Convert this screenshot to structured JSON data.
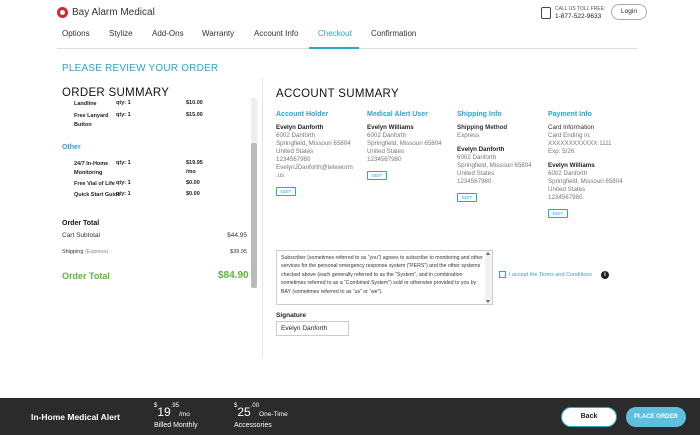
{
  "brand": {
    "logo_text": "Bay Alarm Medical",
    "accent": "#2aa6c9",
    "green": "#5db442",
    "logo_red": "#d9262c"
  },
  "header": {
    "call_label": "CALL US TOLL FREE:",
    "phone": "1-877-522-9633",
    "login_label": "Login"
  },
  "nav": {
    "items": [
      {
        "label": "Options"
      },
      {
        "label": "Stylize"
      },
      {
        "label": "Add-Ons"
      },
      {
        "label": "Warranty"
      },
      {
        "label": "Account Info"
      },
      {
        "label": "Checkout",
        "active": true
      },
      {
        "label": "Confirmation"
      }
    ]
  },
  "page": {
    "review_title": "PLEASE REVIEW YOUR ORDER"
  },
  "order_summary": {
    "title": "ORDER SUMMARY",
    "items": [
      {
        "name": "Landline",
        "qty": "qty: 1",
        "price": "$10.00"
      },
      {
        "name": "Free Lanyard Button",
        "qty": "qty: 1",
        "price": "$15.00"
      }
    ],
    "other_heading": "Other",
    "other_items": [
      {
        "name": "24/7 In-Home Monitoring",
        "qty": "qty: 1",
        "price": "$19.95",
        "price2": "/mo"
      },
      {
        "name": "Free Vial of Life",
        "qty": "qty: 1",
        "price": "$0.00"
      },
      {
        "name": "Quick Start Guide",
        "qty": "qty: 1",
        "price": "$0.00"
      }
    ],
    "order_total_label": "Order Total",
    "cart_subtotal_label": "Cart Subtotal",
    "cart_subtotal": "$44.95",
    "shipping_label": "Shipping",
    "shipping_method": "(Express)",
    "shipping_value": "$39.95",
    "grand_label": "Order Total",
    "grand_value": "$84.90"
  },
  "account_summary": {
    "title": "ACCOUNT SUMMARY",
    "edit_label": "EDIT",
    "holder": {
      "heading": "Account Holder",
      "name": "Evelyn Danforth",
      "address1": "6002 Danforth",
      "address2": "Springfield, Missouri 65804",
      "country": "United States",
      "phone": "1234567980",
      "email1": "EvelynJDanforth@teleworm",
      "email2": ".us"
    },
    "user": {
      "heading": "Medical Alert User",
      "name": "Evelyn Williams",
      "address1": "6002 Danforth",
      "address2": "Springfield, Missouri 65804",
      "country": "United States",
      "phone": "1234567980"
    },
    "shipping": {
      "heading": "Shipping Info",
      "method_label": "Shipping Method",
      "method": "Express",
      "name": "Evelyn Danforth",
      "address1": "6002 Danforth",
      "address2": "Springfield, Missouri 65804",
      "country": "United States",
      "phone": "1234567980"
    },
    "payment": {
      "heading": "Payment Info",
      "card_label": "Card Information",
      "card_ending": "Card Ending in:",
      "card_number": "XXXXXXXXXXXX 1111",
      "exp": "Exp: 5/26",
      "name": "Evelyn Williams",
      "address1": "6002 Danforth",
      "address2": "Springfield, Missouri 65804",
      "country": "United States",
      "phone": "1234567980"
    }
  },
  "terms": {
    "text": "Subscriber (sometimes referred to as “you”) agrees to subscribe to monitoring and other services for the personal emergency response system (“PERS”) and the other systems checked above (each generally referred to as the “System”, and in combination sometimes referred to as a “Combined System”) sold or otherwise provided to you by BAY (sometimes referred to as “us” or “we”).",
    "accept_label": "I accept the Terms and Conditions",
    "info_glyph": "i"
  },
  "signature": {
    "label": "Signature",
    "value": "Evelyn Danforth"
  },
  "footer": {
    "product": "In-Home Medical Alert",
    "price1_dollar": "$",
    "price1_main": "19",
    "price1_cents": ".95",
    "price1_unit": "/mo",
    "price1_sub": "Billed Monthly",
    "price2_dollar": "$",
    "price2_main": "25",
    "price2_cents": ".00",
    "price2_unit": "One-Time",
    "price2_sub": "Accessories",
    "back_label": "Back",
    "place_label": "PLACE ORDER"
  }
}
